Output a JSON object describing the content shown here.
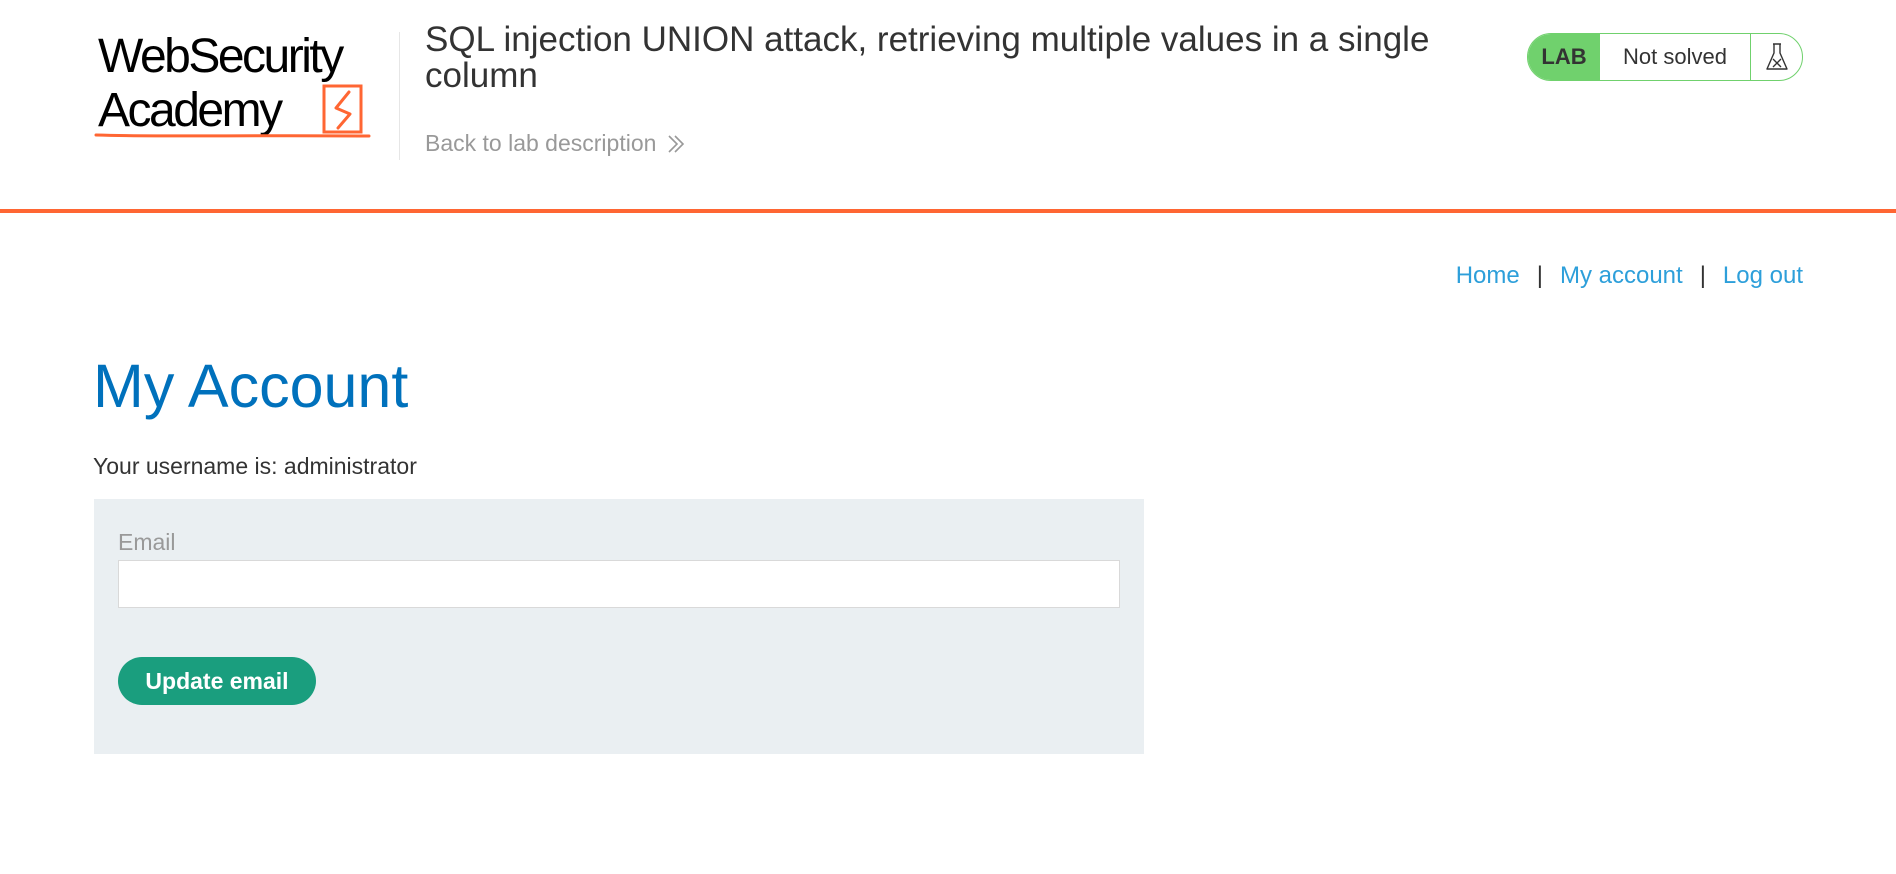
{
  "header": {
    "logo": {
      "line1": "WebSecurity",
      "line2": "Academy",
      "accent_color": "#ff6633"
    },
    "lab_title": "SQL injection UNION attack, retrieving multiple values in a single column",
    "back_link": {
      "label": "Back to lab description",
      "icon": "double-chevron-right-icon"
    },
    "status": {
      "tag": "LAB",
      "text": "Not solved",
      "icon": "flask-icon",
      "color": "#70d16d"
    }
  },
  "nav": {
    "items": [
      {
        "label": "Home"
      },
      {
        "label": "My account"
      },
      {
        "label": "Log out"
      }
    ],
    "separator": "|",
    "link_color": "#2d9fda"
  },
  "main": {
    "heading": "My Account",
    "username_line": "Your username is: administrator",
    "form": {
      "email_label": "Email",
      "email_value": "",
      "button_label": "Update email",
      "button_color": "#1a9e7e"
    }
  }
}
